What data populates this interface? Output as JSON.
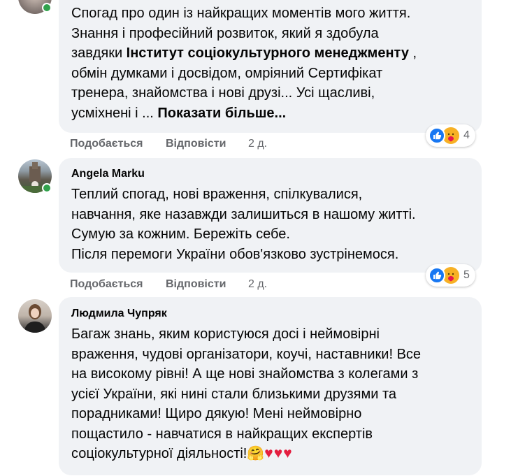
{
  "comments": [
    {
      "author": "",
      "lines": [
        {
          "text": "Спогад про один із найкращих моментів мого життя."
        },
        {
          "text": "Знання і професійний розвиток, який я здобула"
        },
        {
          "pre": "завдяки ",
          "bold": "Інститут соціокультурного менеджменту",
          "post": " ,"
        },
        {
          "text": "обмін думками і досвідом, омріяний Сертифікат"
        },
        {
          "text": "тренера, знайомства і нові друзі... Усі щасливі,"
        },
        {
          "pre": "усміхнені і ... ",
          "bold": "Показати більше..."
        }
      ],
      "like_label": "Подобається",
      "reply_label": "Відповісти",
      "time": "2 д.",
      "reaction_count": "4"
    },
    {
      "author": "Angela Marku",
      "lines": [
        {
          "text": "Теплий спогад, нові враження, спілкувалися,"
        },
        {
          "text": "навчання, яке назавжди залишиться в нашому житті."
        },
        {
          "text": "Сумую за кожним. Бережіть себе."
        },
        {
          "text": "Після перемоги України обов'язково зустрінемося."
        }
      ],
      "like_label": "Подобається",
      "reply_label": "Відповісти",
      "time": "2 д.",
      "reaction_count": "5"
    },
    {
      "author": "Людмила Чупряк",
      "lines": [
        {
          "text": "Багаж знань, яким користуюся досі і неймовірні"
        },
        {
          "text": "враження, чудові організатори, коучі, наставники! Все"
        },
        {
          "text": "на високому рівні! А ще нові знайомства з колегами з"
        },
        {
          "text": "усієї України, які нині стали близькими друзями та"
        },
        {
          "text": "порадниками! Щиро дякую! Мені неймовірно"
        },
        {
          "text": "пощастило - навчатися в найкращих експертів"
        },
        {
          "pre": "соціокультурної діяльності!",
          "emoji": "🤗",
          "hearts": "♥♥♥"
        }
      ]
    }
  ],
  "colors": {
    "bubble": "#f0f2f5",
    "online": "#31a24c",
    "like_reaction": "#1877f2",
    "care_reaction": "#f7b125",
    "secondary_text": "#65676b"
  },
  "icons": [
    "avatar",
    "online-dot",
    "like-reaction-icon",
    "care-reaction-icon",
    "hugging-face-emoji",
    "heart-emoji"
  ]
}
